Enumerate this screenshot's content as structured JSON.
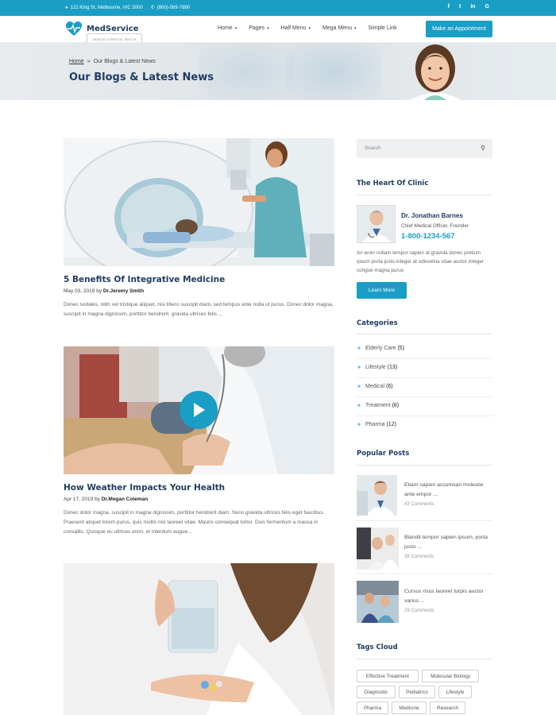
{
  "topbar": {
    "address": "121 King St, Melbourne, VIC 3000",
    "phone": "(800)-569-7890",
    "social": [
      "f",
      "t",
      "in",
      "G"
    ]
  },
  "header": {
    "logo_name": "MedService",
    "logo_tagline": "MEDICAL & MEDICAL HEALTH",
    "nav": [
      {
        "label": "Home",
        "caret": "▾"
      },
      {
        "label": "Pages",
        "caret": "▾"
      },
      {
        "label": "Half Menu",
        "caret": "▾"
      },
      {
        "label": "Mega Menu",
        "caret": "▾"
      },
      {
        "label": "Simple Link",
        "caret": ""
      }
    ],
    "cta": "Make an Appointment"
  },
  "banner": {
    "crumb_home": "Home",
    "crumb_sep": "»",
    "crumb_current": "Our Blogs & Latest News",
    "title": "Our Blogs & Latest News"
  },
  "posts": [
    {
      "title": "5 Benefits Of Integrative Medicine",
      "date": "May 03, 2019",
      "by": "by",
      "author": "Dr.Jeremy Smith",
      "excerpt": "Donec sodales, nibh vel tristique aliquet, nisi libero suscipit diam, sed tempus ante nulla ut purus. Donec dolor magna, suscipit in magna dignissim, porttitor hendrerit. gravida ultrices felis ..."
    },
    {
      "title": "How Weather Impacts Your Health",
      "date": "Apr 17, 2019",
      "by": "by",
      "author": "Dr.Megan Coleman",
      "excerpt": "Donec dolor magna, suscipit in magna dignissim, porttitor hendrerit diam. Nunc gravida ultrices felis eget faucibus. Praesent aliquet lorem purus, quis mollis nisl laoreet vitae. Mauris consequat tortor. Duis fermentum a massa in convallis. Quisque eu ultrices enim, et interdum augue..."
    }
  ],
  "sidebar": {
    "search_placeholder": "Search",
    "clinic_title": "The Heart Of Clinic",
    "doctor_name": "Dr. Jonathan Barnes",
    "doctor_role": "Chief Medical Officer, Founder",
    "doctor_phone": "1-800-1234-567",
    "doctor_desc": "An enim nullam tempor sapien at gravida donec pretium ipsum porta justo integer at odiovelna vitae auctor integer congue magna purus",
    "learn_more": "Learn More",
    "categories_title": "Categories",
    "categories": [
      {
        "label": "Elderly Care",
        "count": "(5)"
      },
      {
        "label": "Lifestyle",
        "count": "(13)"
      },
      {
        "label": "Medical",
        "count": "(6)"
      },
      {
        "label": "Treatment",
        "count": "(8)"
      },
      {
        "label": "Pharma",
        "count": "(12)"
      }
    ],
    "popular_title": "Popular Posts",
    "popular": [
      {
        "text": "Etiam sapien accumsan molestie ante empor ...",
        "comments": "43 Comments"
      },
      {
        "text": "Blandit tempor sapien ipsum, porta justo ...",
        "comments": "38 Comments"
      },
      {
        "text": "Cursus risus laoreet turpis auctor varius ...",
        "comments": "29 Comments"
      }
    ],
    "tags_title": "Tags Cloud",
    "tags": [
      "Effective Treatment",
      "Molecular Biology",
      "Diagnostic",
      "Pediatrics",
      "Lifestyle",
      "Pharma",
      "Medicine",
      "Research"
    ]
  },
  "colors": {
    "accent": "#1a9ec5",
    "navy": "#1f3c63"
  }
}
